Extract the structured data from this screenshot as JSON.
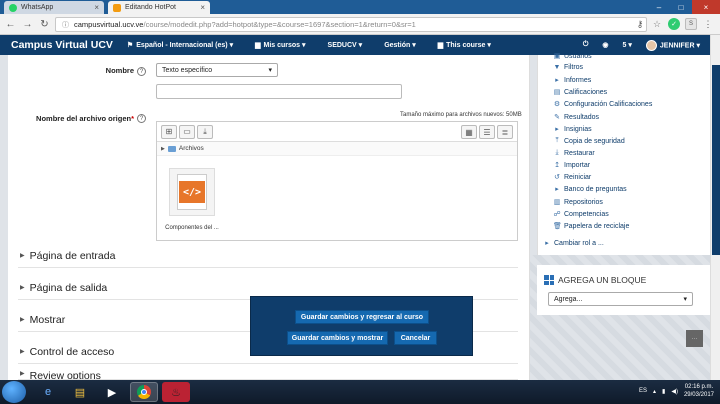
{
  "browser": {
    "tabs": [
      {
        "label": "WhatsApp",
        "icon": "whatsapp-icon",
        "color": "#25d366"
      },
      {
        "label": "Editando HotPot",
        "icon": "moodle-icon",
        "color": "#f39c12"
      }
    ],
    "url_domain": "campusvirtual.ucv.ve",
    "url_path": "/course/modedit.php?add=hotpot&type=&course=1697&section=1&return=0&sr=1"
  },
  "navbar": {
    "brand": "Campus Virtual UCV",
    "language": "Español - Internacional (es)",
    "my_courses": "Mis cursos",
    "seducv": "SEDUCV",
    "gestion": "Gestión",
    "this_course": "This course",
    "messages_count": "5",
    "user": "JENNIFER"
  },
  "form": {
    "nombre_label": "Nombre",
    "nombre_select": "Texto específico",
    "archivo_label": "Nombre del archivo origen",
    "max_size": "Tamaño máximo para archivos nuevos: 50MB",
    "folder_label": "Archivos",
    "file_name": "Componentes del ...",
    "sections": [
      "Página de entrada",
      "Página de salida",
      "Mostrar",
      "Control de acceso",
      "Review options"
    ]
  },
  "actions": {
    "save_return": "Guardar cambios y regresar al curso",
    "save_show": "Guardar cambios y mostrar",
    "cancel": "Cancelar"
  },
  "sidebar": {
    "items": [
      {
        "label": "Usuarios",
        "icon": "users-icon"
      },
      {
        "label": "Filtros",
        "icon": "filter-icon"
      },
      {
        "label": "Informes",
        "icon": "folder-icon"
      },
      {
        "label": "Calificaciones",
        "icon": "grades-icon"
      },
      {
        "label": "Configuración Calificaciones",
        "icon": "gear-icon"
      },
      {
        "label": "Resultados",
        "icon": "pencil-icon"
      },
      {
        "label": "Insignias",
        "icon": "folder-icon"
      },
      {
        "label": "Copia de seguridad",
        "icon": "backup-icon"
      },
      {
        "label": "Restaurar",
        "icon": "restore-icon"
      },
      {
        "label": "Importar",
        "icon": "import-icon"
      },
      {
        "label": "Reiniciar",
        "icon": "reset-icon"
      },
      {
        "label": "Banco de preguntas",
        "icon": "folder-icon"
      },
      {
        "label": "Repositorios",
        "icon": "repo-icon"
      },
      {
        "label": "Competencias",
        "icon": "competency-icon"
      },
      {
        "label": "Papelera de reciclaje",
        "icon": "trash-icon"
      }
    ],
    "switch_role": "Cambiar rol a ...",
    "add_block_title": "AGREGA UN BLOQUE",
    "add_block_select": "Agrega..."
  },
  "taskbar": {
    "lang": "ES",
    "time": "02:16 p.m.",
    "date": "29/03/2017"
  }
}
